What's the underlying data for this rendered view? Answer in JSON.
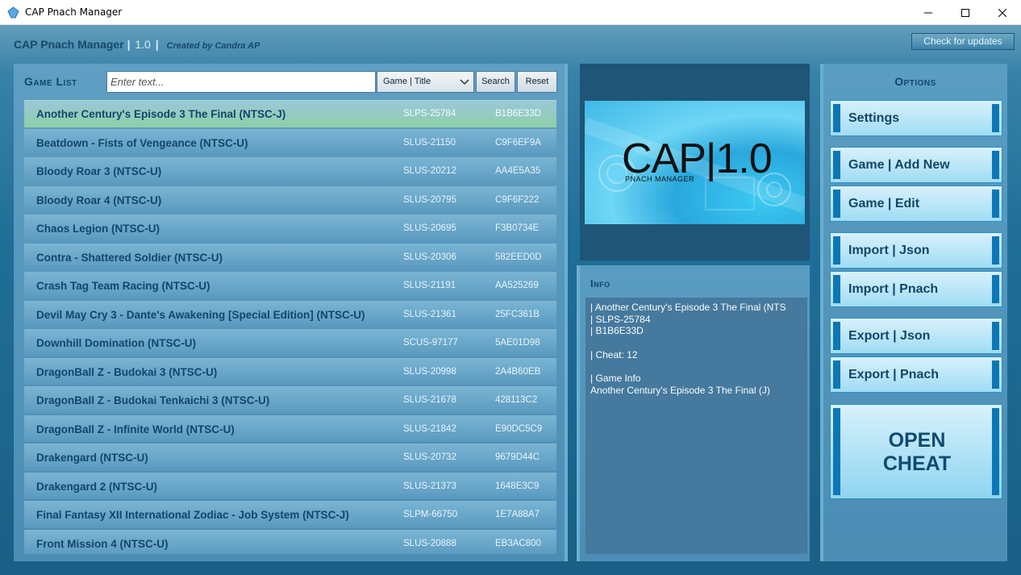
{
  "window": {
    "title": "CAP Pnach Manager",
    "icon": "app-cap-icon"
  },
  "header": {
    "app_name": "CAP Pnach Manager",
    "separator": "|",
    "version": "1.0",
    "credit": "Created by Candra AP",
    "update_button": "Check for updates"
  },
  "game_list": {
    "title": "Game List",
    "search_placeholder": "Enter text...",
    "filter_selected": "Game | Title",
    "search_button": "Search",
    "reset_button": "Reset",
    "selected_index": 0,
    "rows": [
      {
        "name": "Another Century's Episode 3 The Final (NTSC-J)",
        "serial": "SLPS-25784",
        "crc": "B1B6E33D"
      },
      {
        "name": "Beatdown - Fists of Vengeance (NTSC-U)",
        "serial": "SLUS-21150",
        "crc": "C9F6EF9A"
      },
      {
        "name": "Bloody Roar 3 (NTSC-U)",
        "serial": "SLUS-20212",
        "crc": "AA4E5A35"
      },
      {
        "name": "Bloody Roar 4 (NTSC-U)",
        "serial": "SLUS-20795",
        "crc": "C9F6F222"
      },
      {
        "name": "Chaos Legion (NTSC-U)",
        "serial": "SLUS-20695",
        "crc": "F3B0734E"
      },
      {
        "name": "Contra - Shattered Soldier (NTSC-U)",
        "serial": "SLUS-20306",
        "crc": "582EED0D"
      },
      {
        "name": "Crash Tag Team Racing (NTSC-U)",
        "serial": "SLUS-21191",
        "crc": "AA525269"
      },
      {
        "name": "Devil May Cry 3 - Dante's Awakening [Special Edition] (NTSC-U)",
        "serial": "SLUS-21361",
        "crc": "25FC361B"
      },
      {
        "name": "Downhill Domination (NTSC-U)",
        "serial": "SCUS-97177",
        "crc": "5AE01D98"
      },
      {
        "name": "DragonBall Z - Budokai 3 (NTSC-U)",
        "serial": "SLUS-20998",
        "crc": "2A4B60EB"
      },
      {
        "name": "DragonBall Z - Budokai Tenkaichi 3 (NTSC-U)",
        "serial": "SLUS-21678",
        "crc": "428113C2"
      },
      {
        "name": "DragonBall Z - Infinite World (NTSC-U)",
        "serial": "SLUS-21842",
        "crc": "E90DC5C9"
      },
      {
        "name": "Drakengard (NTSC-U)",
        "serial": "SLUS-20732",
        "crc": "9679D44C"
      },
      {
        "name": "Drakengard 2 (NTSC-U)",
        "serial": "SLUS-21373",
        "crc": "1648E3C9"
      },
      {
        "name": "Final Fantasy XII International Zodiac - Job System (NTSC-J)",
        "serial": "SLPM-66750",
        "crc": "1E7A88A7"
      },
      {
        "name": "Front Mission 4 (NTSC-U)",
        "serial": "SLUS-20888",
        "crc": "EB3AC800"
      }
    ]
  },
  "banner": {
    "big_text": "CAP|1.0",
    "sub_text": "PNACH MANAGER"
  },
  "info": {
    "title": "Info",
    "text": "| Another Century's Episode 3 The Final (NTS\n| SLPS-25784\n| B1B6E33D\n\n| Cheat: 12\n\n| Game Info\nAnother Century's Episode 3 The Final (J)"
  },
  "options": {
    "title": "Options",
    "settings": "Settings",
    "game_add_new": "Game | Add New",
    "game_edit": "Game | Edit",
    "import_json": "Import | Json",
    "import_pnach": "Import | Pnach",
    "export_json": "Export | Json",
    "export_pnach": "Export | Pnach",
    "open_cheat": "OPEN\nCHEAT"
  }
}
